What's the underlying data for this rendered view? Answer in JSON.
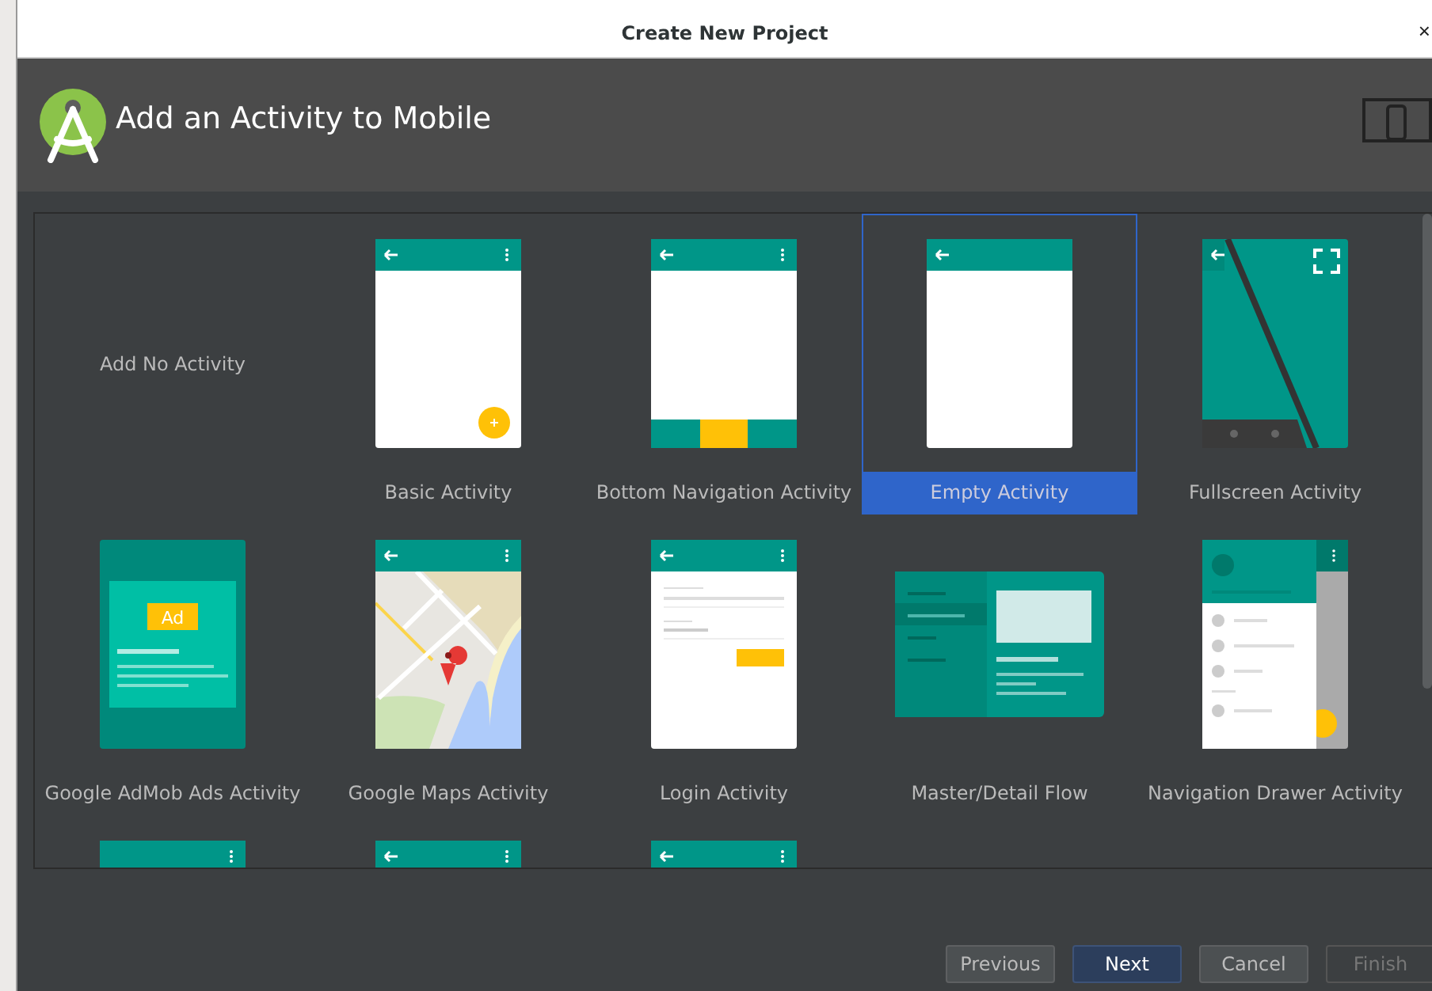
{
  "window": {
    "title": "Create New Project",
    "close": "×"
  },
  "header": {
    "title": "Add an Activity to Mobile"
  },
  "templates": [
    {
      "kind": "none",
      "label": "Add No Activity",
      "selected": false
    },
    {
      "kind": "basic",
      "label": "Basic Activity",
      "selected": false
    },
    {
      "kind": "bottom-nav",
      "label": "Bottom Navigation Activity",
      "selected": false
    },
    {
      "kind": "empty",
      "label": "Empty Activity",
      "selected": true
    },
    {
      "kind": "fullscreen",
      "label": "Fullscreen Activity",
      "selected": false
    },
    {
      "kind": "admob",
      "label": "Google AdMob Ads Activity",
      "selected": false,
      "badge": "Ad"
    },
    {
      "kind": "maps",
      "label": "Google Maps Activity",
      "selected": false
    },
    {
      "kind": "login",
      "label": "Login Activity",
      "selected": false
    },
    {
      "kind": "master-detail",
      "label": "Master/Detail Flow",
      "selected": false
    },
    {
      "kind": "nav-drawer",
      "label": "Navigation Drawer Activity",
      "selected": false
    },
    {
      "kind": "menu-only",
      "selected": false
    },
    {
      "kind": "back-menu",
      "selected": false
    },
    {
      "kind": "back-menu",
      "selected": false
    }
  ],
  "buttons": [
    {
      "label": "Previous",
      "kind": "normal",
      "disabled": false
    },
    {
      "label": "Next",
      "kind": "default",
      "disabled": false
    },
    {
      "label": "Cancel",
      "kind": "normal",
      "disabled": false
    },
    {
      "label": "Finish",
      "kind": "normal",
      "disabled": true
    }
  ]
}
